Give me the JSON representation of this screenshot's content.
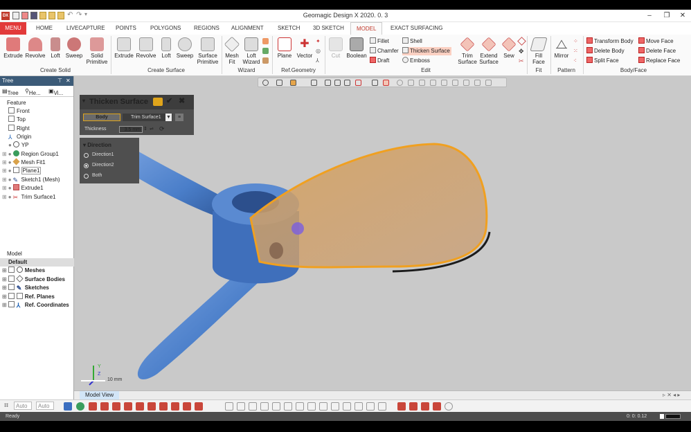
{
  "window": {
    "title": "Geomagic Design X 2020. 0. 3",
    "logo": "DX"
  },
  "menubar": {
    "menu": "MENU",
    "tabs": [
      "HOME",
      "LIVECAPTURE",
      "POINTS",
      "POLYGONS",
      "REGIONS",
      "ALIGNMENT",
      "SKETCH",
      "3D SKETCH",
      "MODEL",
      "EXACT SURFACING"
    ],
    "active_tab": "MODEL"
  },
  "ribbon": {
    "create_solid": {
      "label": "Create Solid",
      "buttons": [
        "Extrude",
        "Revolve",
        "Loft",
        "Sweep",
        "Solid Primitive"
      ]
    },
    "create_surface": {
      "label": "Create Surface",
      "buttons": [
        "Extrude",
        "Revolve",
        "Loft",
        "Sweep",
        "Surface Primitive"
      ]
    },
    "wizard": {
      "label": "Wizard",
      "buttons": [
        "Mesh Fit",
        "Loft Wizard"
      ]
    },
    "ref_geometry": {
      "label": "Ref.Geometry",
      "buttons": [
        "Plane",
        "Vector"
      ]
    },
    "edit": {
      "label": "Edit",
      "cut": "Cut",
      "boolean": "Boolean",
      "fillet": "Fillet",
      "chamfer": "Chamfer",
      "draft": "Draft",
      "shell": "Shell",
      "thicken_surface": "Thicken Surface",
      "emboss": "Emboss",
      "trim_surface": "Trim Surface",
      "extend_surface": "Extend Surface",
      "sew": "Sew"
    },
    "fit": {
      "label": "Fit",
      "fill_face": "Fill Face"
    },
    "pattern": {
      "label": "Pattern",
      "mirror": "Mirror"
    },
    "body_face": {
      "label": "Body/Face",
      "transform_body": "Transform Body",
      "delete_body": "Delete Body",
      "split_face": "Split Face",
      "move_face": "Move Face",
      "delete_face": "Delete Face",
      "replace_face": "Replace Face"
    }
  },
  "tree_panel": {
    "header": "Tree",
    "tabs": [
      "Tree",
      "He...",
      "Vi..."
    ],
    "feature_label": "Feature",
    "features": [
      "Front",
      "Top",
      "Right",
      "Origin",
      "YP",
      "Region Group1",
      "Mesh Fit1",
      "Plane1",
      "Sketch1 (Mesh)",
      "Extrude1",
      "Trim Surface1"
    ],
    "model_label": "Model",
    "default_label": "Default",
    "model_items": [
      "Meshes",
      "Surface Bodies",
      "Sketches",
      "Ref. Planes",
      "Ref. Coordinates"
    ]
  },
  "dialog": {
    "title": "Thicken Surface",
    "body_tab": "Body",
    "body_select": "Trim Surface1",
    "thickness_label": "Thickness",
    "thickness_value": "3.5 mm",
    "direction_title": "Direction",
    "options": [
      "Direction1",
      "Direction2",
      "Both"
    ],
    "selected_option": "Direction2"
  },
  "viewport": {
    "scale_label": "10 mm",
    "axis_labels": [
      "Y",
      "Z"
    ]
  },
  "bottom": {
    "model_view_tab": "Model View",
    "auto1": "Auto",
    "auto2": "Auto",
    "status": "Ready",
    "clock": "0: 0: 0.12"
  },
  "colors": {
    "propeller": "#4a7ec9",
    "surface_fill": "#d9a24a",
    "surface_edge": "#f0a020",
    "accent_red": "#e23a3a"
  }
}
